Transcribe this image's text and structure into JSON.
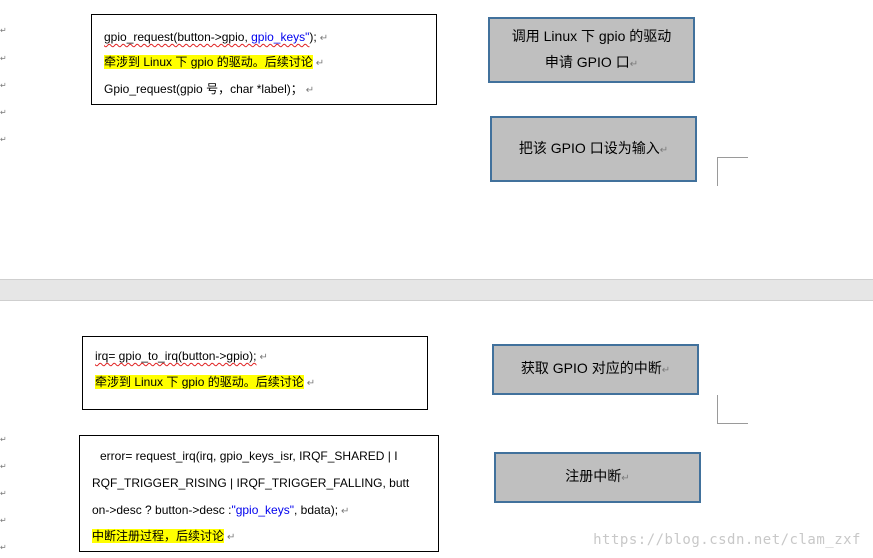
{
  "paragraph_mark": "↵",
  "page1": {
    "code_box": {
      "line1": {
        "prefix": "gpio_request(button->gpio, ",
        "keyword": "gpio_keys\"",
        "suffix": ");"
      },
      "line2": "牵涉到 Linux 下 gpio 的驱动。后续讨论",
      "line3": "Gpio_request(gpio 号，char *label)；"
    },
    "flow_box_1": {
      "line1": "调用 Linux 下 gpio 的驱动",
      "line2": "申请 GPIO 口"
    },
    "flow_box_2": "把该 GPIO 口设为输入"
  },
  "page2": {
    "code_box_1": {
      "line1": "irq= gpio_to_irq(button->gpio);",
      "line2": "牵涉到 Linux 下 gpio 的驱动。后续讨论"
    },
    "code_box_2": {
      "line1": "error= request_irq(irq, gpio_keys_isr, IRQF_SHARED |  I",
      "line2": "RQF_TRIGGER_RISING | IRQF_TRIGGER_FALLING,  butt",
      "line3": {
        "prefix": "on->desc ? button->desc :",
        "keyword": "\"gpio_keys\"",
        "suffix": ",    bdata);"
      },
      "line4": "中断注册过程，后续讨论"
    },
    "flow_box_1": "获取 GPIO 对应的中断",
    "flow_box_2": "注册中断"
  },
  "watermark": "https://blog.csdn.net/clam_zxf",
  "colors": {
    "highlight": "#ffff00",
    "flow_box_fill": "#bfbfbf",
    "flow_box_border": "#41719c",
    "string_blue": "#0000ee"
  }
}
